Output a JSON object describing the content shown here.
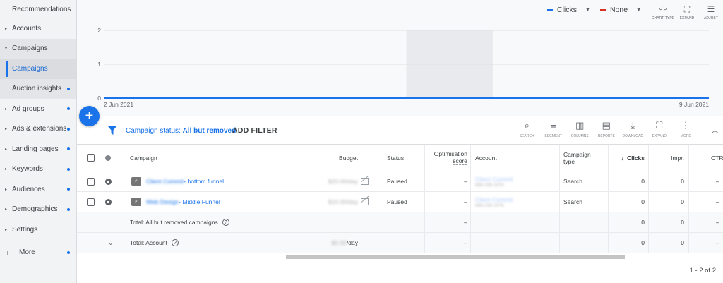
{
  "sidebar": {
    "items": [
      {
        "label": "Recommendations",
        "caret": "",
        "dot": false
      },
      {
        "label": "Accounts",
        "caret": "▸",
        "dot": false
      },
      {
        "label": "Campaigns",
        "caret": "▾",
        "dot": false
      },
      {
        "label": "Campaigns",
        "caret": "",
        "dot": false
      },
      {
        "label": "Auction insights",
        "caret": "",
        "dot": true
      },
      {
        "label": "Ad groups",
        "caret": "▸",
        "dot": true
      },
      {
        "label": "Ads & extensions",
        "caret": "▸",
        "dot": true
      },
      {
        "label": "Landing pages",
        "caret": "▸",
        "dot": true
      },
      {
        "label": "Keywords",
        "caret": "▸",
        "dot": true
      },
      {
        "label": "Audiences",
        "caret": "▸",
        "dot": true
      },
      {
        "label": "Demographics",
        "caret": "▸",
        "dot": true
      },
      {
        "label": "Settings",
        "caret": "▸",
        "dot": false
      }
    ],
    "more_label": "More"
  },
  "chart_controls": {
    "metric1": "Clicks",
    "metric1_color": "#1a73e8",
    "metric2": "None",
    "metric2_color": "#d93025",
    "tools": [
      {
        "icon": "chart-type-icon",
        "glyph": "〰",
        "label": "CHART TYPE"
      },
      {
        "icon": "expand-icon",
        "glyph": "⛶",
        "label": "EXPAND"
      },
      {
        "icon": "adjust-icon",
        "glyph": "☰",
        "label": "ADJUST"
      }
    ]
  },
  "chart_data": {
    "type": "line",
    "x": [
      "2 Jun 2021",
      "3 Jun 2021",
      "4 Jun 2021",
      "5 Jun 2021",
      "6 Jun 2021",
      "7 Jun 2021",
      "8 Jun 2021",
      "9 Jun 2021"
    ],
    "series": [
      {
        "name": "Clicks",
        "values": [
          0,
          0,
          0,
          0,
          0,
          0,
          0,
          0
        ]
      }
    ],
    "yticks": [
      "0",
      "1",
      "2"
    ],
    "ylim": [
      0,
      2
    ],
    "xtick_labels": [
      "2 Jun 2021",
      "9 Jun 2021"
    ],
    "highlight_x_range": [
      "5 Jun 2021",
      "6 Jun 2021"
    ],
    "series_color": "#1a73e8",
    "grid": true
  },
  "fab_glyph": "+",
  "filter": {
    "prefix": "Campaign status: ",
    "value": "All but removed",
    "add_filter": "ADD FILTER"
  },
  "table_tools": [
    {
      "icon": "search-icon",
      "glyph": "⌕",
      "label": "SEARCH"
    },
    {
      "icon": "segment-icon",
      "glyph": "≡",
      "label": "SEGMENT"
    },
    {
      "icon": "columns-icon",
      "glyph": "▥",
      "label": "COLUMNS"
    },
    {
      "icon": "reports-icon",
      "glyph": "▤",
      "label": "REPORTS"
    },
    {
      "icon": "download-icon",
      "glyph": "⤓",
      "label": "DOWNLOAD"
    },
    {
      "icon": "expand-icon",
      "glyph": "⛶",
      "label": "EXPAND"
    },
    {
      "icon": "more-icon",
      "glyph": "⋮",
      "label": "MORE"
    }
  ],
  "collapse_glyph": "︿",
  "table": {
    "headers": {
      "campaign": "Campaign",
      "budget": "Budget",
      "status": "Status",
      "opt_score_1": "Optimisation",
      "opt_score_2": "score",
      "account": "Account",
      "campaign_type_1": "Campaign",
      "campaign_type_2": "type",
      "clicks": "Clicks",
      "impr": "Impr.",
      "ctr": "CTR"
    },
    "rows": [
      {
        "name_blur": "Client Commit",
        "name_suffix": " - bottom funnel",
        "budget_blur": "$20.00/day",
        "status": "Paused",
        "opt": "–",
        "account_blur": "Client Commit",
        "account_id_blur": "866-239-1576",
        "type": "Search",
        "clicks": "0",
        "impr": "0",
        "ctr": "–"
      },
      {
        "name_blur": "Web Design",
        "name_suffix": " - Middle Funnel",
        "budget_blur": "$10.00/day",
        "status": "Paused",
        "opt": "–",
        "account_blur": "Client Commit",
        "account_id_blur": "866-239-1576",
        "type": "Search",
        "clicks": "0",
        "impr": "0",
        "ctr": "–"
      }
    ],
    "total_removed": {
      "label": "Total: All but removed campaigns",
      "opt": "–",
      "clicks": "0",
      "impr": "0",
      "ctr": "–"
    },
    "total_account": {
      "label": "Total: Account",
      "budget_blur": "$0.00",
      "budget_suffix": "/day",
      "opt": "–",
      "clicks": "0",
      "impr": "0",
      "ctr": "–"
    }
  },
  "pager": "1 - 2 of 2"
}
